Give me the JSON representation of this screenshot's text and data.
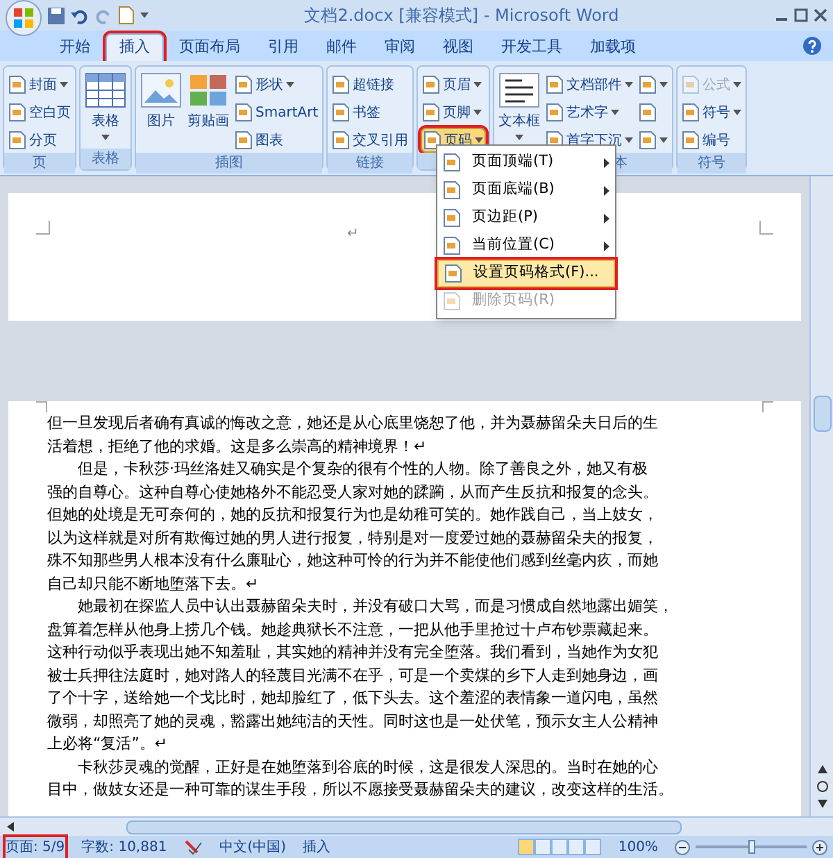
{
  "title_bar": {
    "title": "文档2.docx [兼容模式] - Microsoft Word"
  },
  "tabs": [
    {
      "label": "开始",
      "selected": false,
      "annotated": false
    },
    {
      "label": "插入",
      "selected": true,
      "annotated": true
    },
    {
      "label": "页面布局",
      "selected": false,
      "annotated": false
    },
    {
      "label": "引用",
      "selected": false,
      "annotated": false
    },
    {
      "label": "邮件",
      "selected": false,
      "annotated": false
    },
    {
      "label": "审阅",
      "selected": false,
      "annotated": false
    },
    {
      "label": "视图",
      "selected": false,
      "annotated": false
    },
    {
      "label": "开发工具",
      "selected": false,
      "annotated": false
    },
    {
      "label": "加载项",
      "selected": false,
      "annotated": false
    }
  ],
  "ribbon_groups": [
    {
      "label": "页",
      "items": [
        {
          "label": "封面",
          "kind": "small",
          "dropdown": true
        },
        {
          "label": "空白页",
          "kind": "small",
          "dropdown": false
        },
        {
          "label": "分页",
          "kind": "small",
          "dropdown": false
        }
      ]
    },
    {
      "label": "表格",
      "items": [
        {
          "label": "表格",
          "kind": "large",
          "dropdown": true
        }
      ]
    },
    {
      "label": "插图",
      "items": [
        {
          "label": "图片",
          "kind": "large",
          "dropdown": false
        },
        {
          "label": "剪贴画",
          "kind": "large",
          "dropdown": false
        },
        {
          "label": "形状",
          "kind": "small",
          "dropdown": true
        },
        {
          "label": "SmartArt",
          "kind": "small",
          "dropdown": false
        },
        {
          "label": "图表",
          "kind": "small",
          "dropdown": false
        }
      ]
    },
    {
      "label": "链接",
      "items": [
        {
          "label": "超链接",
          "kind": "small",
          "dropdown": false
        },
        {
          "label": "书签",
          "kind": "small",
          "dropdown": false
        },
        {
          "label": "交叉引用",
          "kind": "small",
          "dropdown": false
        }
      ]
    },
    {
      "items": [
        {
          "label": "页眉",
          "kind": "small",
          "dropdown": true
        },
        {
          "label": "页脚",
          "kind": "small",
          "dropdown": true
        },
        {
          "label": "页码",
          "kind": "small",
          "dropdown": true,
          "pressed": true,
          "annotated": true
        }
      ]
    },
    {
      "label": "本",
      "items": [
        {
          "label": "文本框",
          "kind": "large",
          "dropdown": true
        },
        {
          "label": "文档部件",
          "kind": "small",
          "dropdown": true
        },
        {
          "label": "艺术字",
          "kind": "small",
          "dropdown": true
        },
        {
          "label": "首字下沉",
          "kind": "small",
          "dropdown": true
        },
        {
          "kind": "icon",
          "dropdown": true
        },
        {
          "kind": "icon",
          "dropdown": false
        },
        {
          "kind": "icon",
          "dropdown": true
        }
      ]
    },
    {
      "label": "符号",
      "items": [
        {
          "label": "公式",
          "kind": "small",
          "dropdown": true,
          "disabled": true
        },
        {
          "label": "符号",
          "kind": "small",
          "dropdown": true
        },
        {
          "label": "编号",
          "kind": "small",
          "dropdown": false
        }
      ]
    }
  ],
  "page_number_menu": {
    "items": [
      {
        "label": "页面顶端(T)",
        "submenu": true,
        "highlighted": false,
        "disabled": false,
        "annotated": false
      },
      {
        "label": "页面底端(B)",
        "submenu": true,
        "highlighted": false,
        "disabled": false,
        "annotated": false
      },
      {
        "label": "页边距(P)",
        "submenu": true,
        "highlighted": false,
        "disabled": false,
        "annotated": false
      },
      {
        "label": "当前位置(C)",
        "submenu": true,
        "highlighted": false,
        "disabled": false,
        "annotated": false
      },
      {
        "label": "设置页码格式(F)...",
        "submenu": false,
        "highlighted": true,
        "disabled": false,
        "annotated": true
      },
      {
        "label": "删除页码(R)",
        "submenu": false,
        "highlighted": false,
        "disabled": true,
        "annotated": false
      }
    ]
  },
  "document": {
    "header_mark": "↵",
    "lines": [
      {
        "text": "但一旦发现后者确有真诚的悔改之意，她还是从心底里饶恕了他，并为聂赫留朵夫日后的生",
        "indent": false
      },
      {
        "text": "活着想，拒绝了他的求婚。这是多么崇高的精神境界！↵",
        "indent": false
      },
      {
        "text": "但是，卡秋莎·玛丝洛娃又确实是个复杂的很有个性的人物。除了善良之外，她又有极",
        "indent": true
      },
      {
        "text": "强的自尊心。这种自尊心使她格外不能忍受人家对她的蹂躏，从而产生反抗和报复的念头。",
        "indent": false
      },
      {
        "text": "但她的处境是无可奈何的，她的反抗和报复行为也是幼稚可笑的。她作践自己，当上妓女，",
        "indent": false
      },
      {
        "text": "以为这样就是对所有欺侮过她的男人进行报复，特别是对一度爱过她的聂赫留朵夫的报复，",
        "indent": false
      },
      {
        "text": "殊不知那些男人根本没有什么廉耻心，她这种可怜的行为并不能使他们感到丝毫内疚，而她",
        "indent": false
      },
      {
        "text": "自己却只能不断地堕落下去。↵",
        "indent": false
      },
      {
        "text": "她最初在探监人员中认出聂赫留朵夫时，并没有破口大骂，而是习惯成自然地露出媚笑，",
        "indent": true
      },
      {
        "text": "盘算着怎样从他身上捞几个钱。她趁典狱长不注意，一把从他手里抢过十卢布钞票藏起来。",
        "indent": false
      },
      {
        "text": "这种行动似乎表现出她不知羞耻，其实她的精神并没有完全堕落。我们看到，当她作为女犯",
        "indent": false
      },
      {
        "text": "被士兵押往法庭时，她对路人的轻蔑目光满不在乎，可是一个卖煤的乡下人走到她身边，画",
        "indent": false
      },
      {
        "text": "了个十字，送给她一个戈比时，她却脸红了，低下头去。这个羞涩的表情象一道闪电，虽然",
        "indent": false
      },
      {
        "text": "微弱，却照亮了她的灵魂，豁露出她纯洁的天性。同时这也是一处伏笔，预示女主人公精神",
        "indent": false
      },
      {
        "text": "上必将“复活”。↵",
        "indent": false
      },
      {
        "text": "卡秋莎灵魂的觉醒，正好是在她堕落到谷底的时候，这是很发人深思的。当时在她的心",
        "indent": true
      },
      {
        "text": "目中，做妓女还是一种可靠的谋生手段，所以不愿接受聂赫留朵夫的建议，改变这样的生活。",
        "indent": false
      }
    ]
  },
  "status_bar": {
    "page": "页面: 5/9",
    "page_annotated": true,
    "words": "字数: 10,881",
    "language": "中文(中国)",
    "mode": "插入",
    "zoom": "100%",
    "zoom_slider": {
      "level": 0.5
    }
  }
}
